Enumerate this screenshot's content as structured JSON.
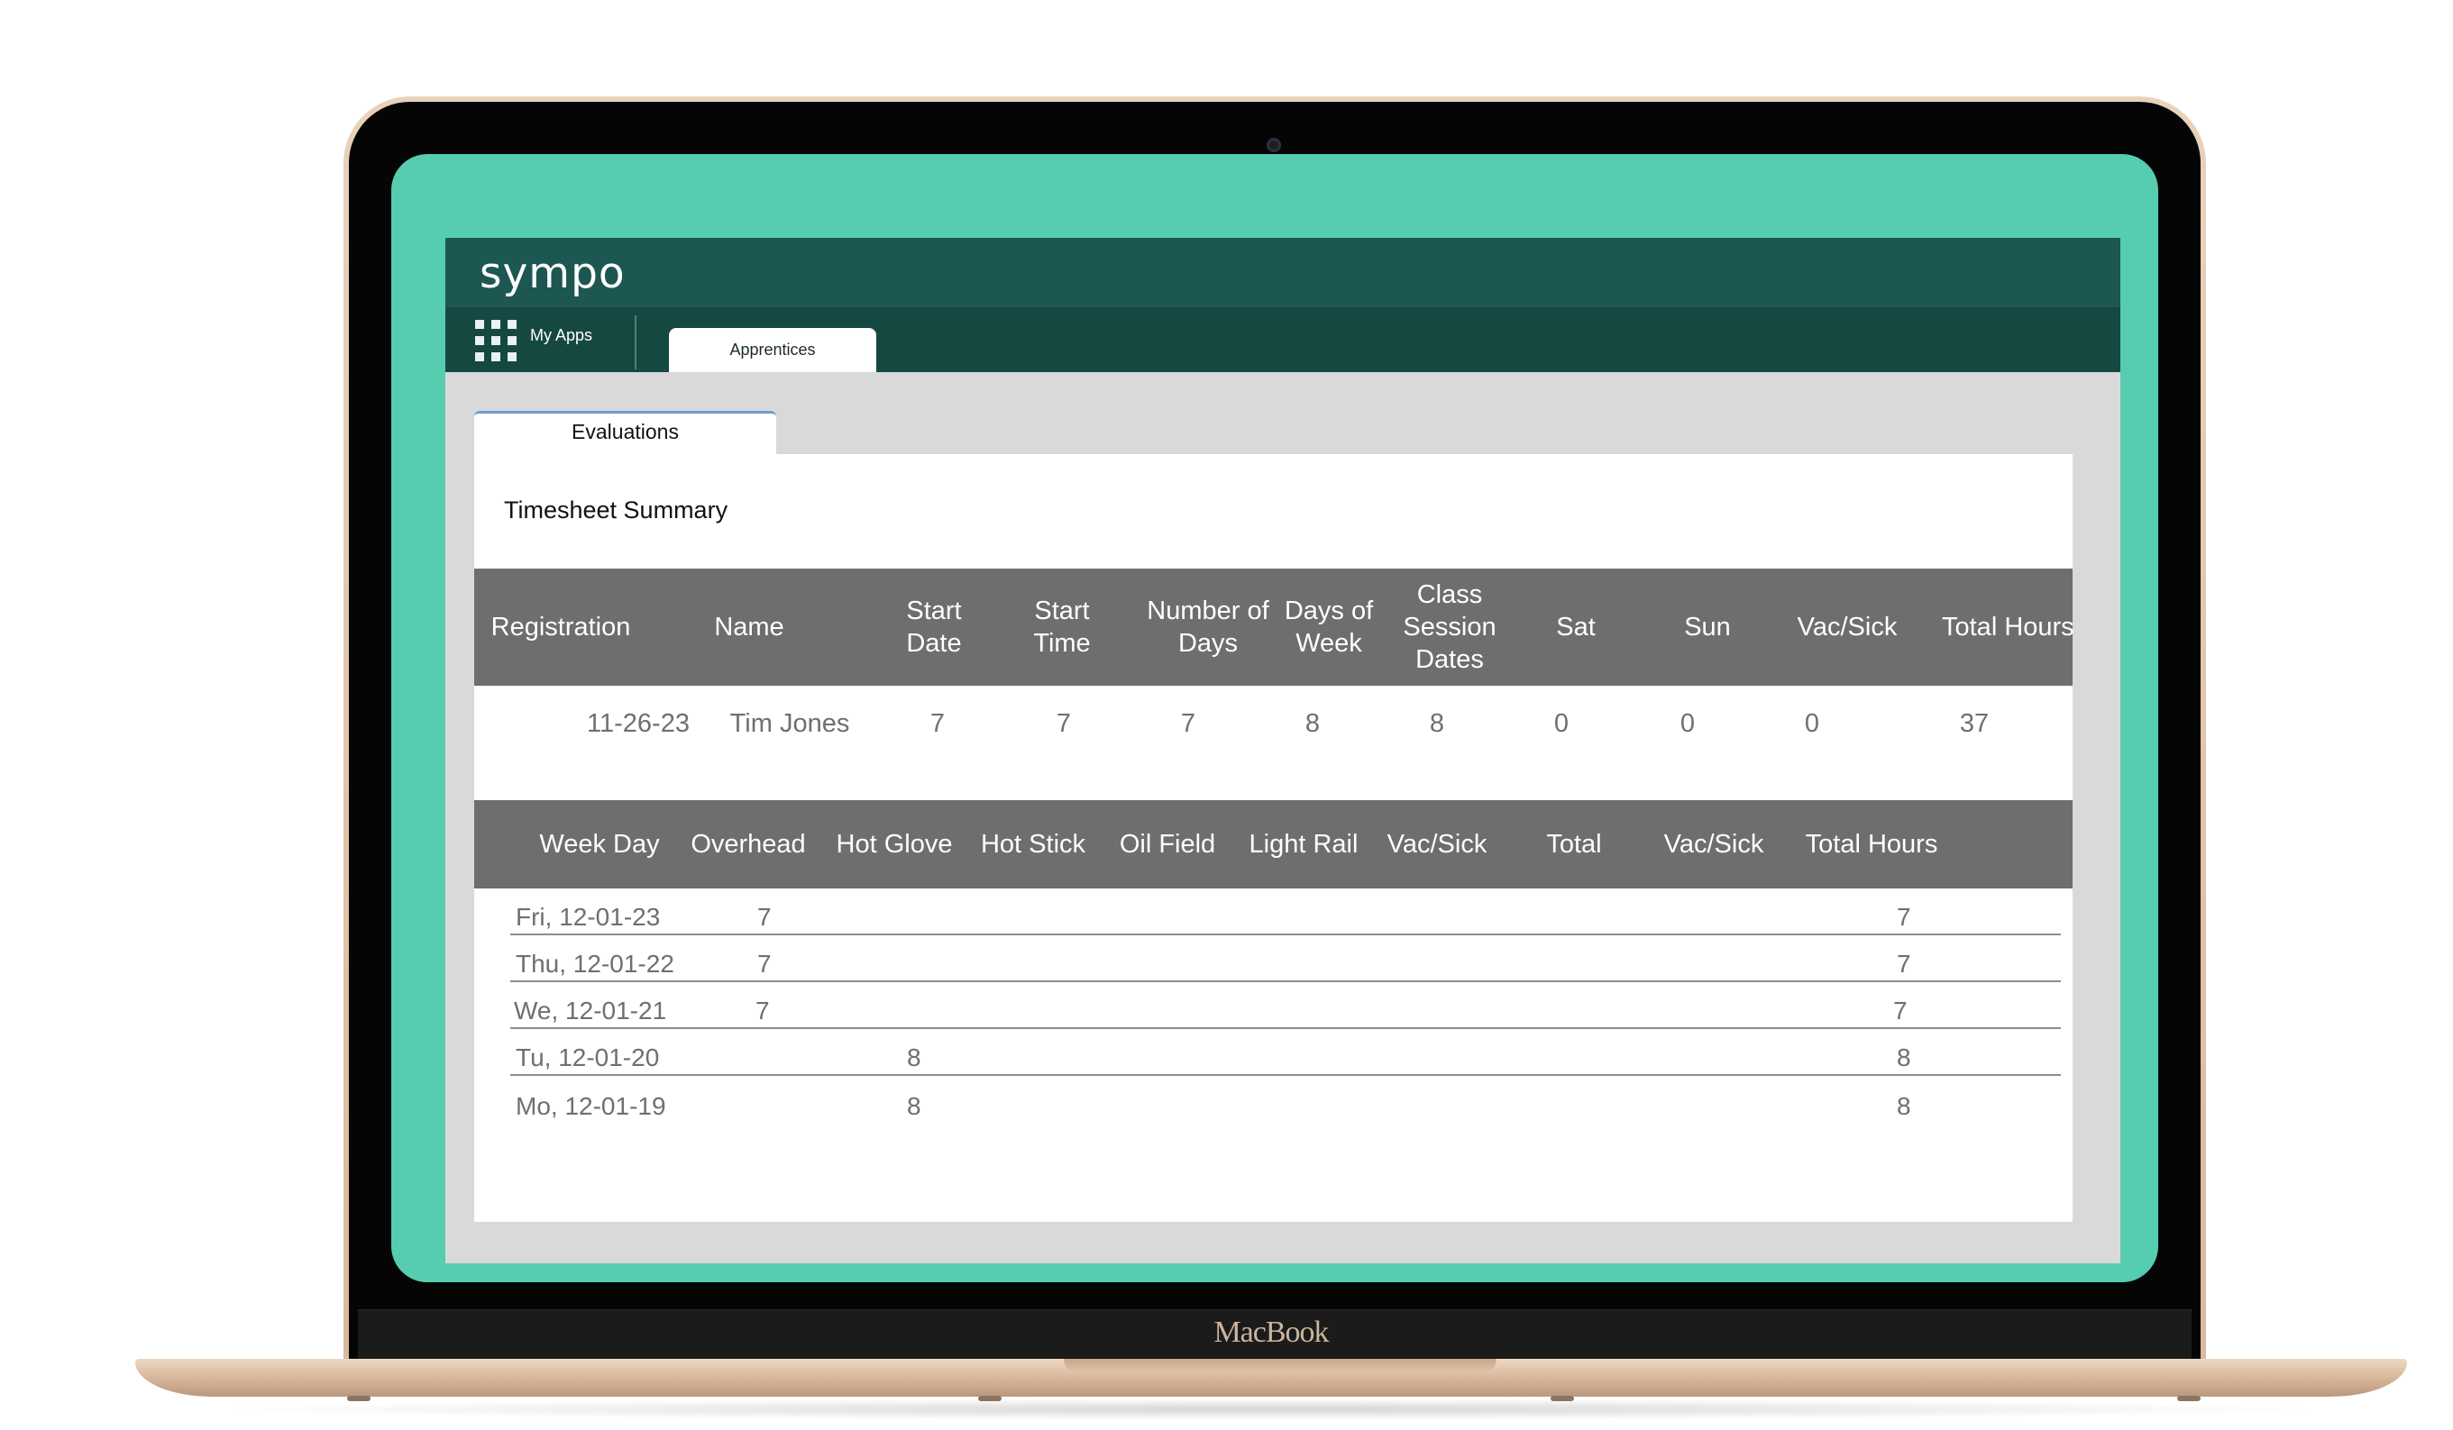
{
  "device": {
    "brand": "MacBook"
  },
  "app": {
    "logo": "sympo",
    "nav": {
      "my_apps_label": "My Apps",
      "active_tab": "Apprentices"
    },
    "subtab": "Evaluations"
  },
  "timesheet": {
    "title": "Timesheet Summary",
    "columns": [
      "Registration",
      "Name",
      "Start Date",
      "Start Time",
      "Number of Days",
      "Days of Week",
      "Class Session Dates",
      "Sat",
      "Sun",
      "Vac/Sick",
      "Total Hours"
    ],
    "rows": [
      [
        "11-26-23",
        "Tim Jones",
        "7",
        "7",
        "7",
        "8",
        "8",
        "0",
        "0",
        "0",
        "37"
      ]
    ]
  },
  "weekly": {
    "columns": [
      "Week Day",
      "Overhead",
      "Hot Glove",
      "Hot Stick",
      "Oil Field",
      "Light Rail",
      "Vac/Sick",
      "Total",
      "Vac/Sick",
      "Total Hours"
    ],
    "rows": [
      {
        "day": "Fri, 12-01-23",
        "overhead": "7",
        "hot_glove": "",
        "total_hours": "7"
      },
      {
        "day": "Thu, 12-01-22",
        "overhead": "7",
        "hot_glove": "",
        "total_hours": "7"
      },
      {
        "day": "We, 12-01-21",
        "overhead": "7",
        "hot_glove": "",
        "total_hours": "7"
      },
      {
        "day": "Tu, 12-01-20",
        "overhead": "",
        "hot_glove": "8",
        "total_hours": "8"
      },
      {
        "day": "Mo, 12-01-19",
        "overhead": "",
        "hot_glove": "8",
        "total_hours": "8"
      }
    ]
  },
  "colors": {
    "screen_background": "#56ccb1",
    "topbar": "#1d5751",
    "navbar": "#164842",
    "table_header": "#6e6e6e",
    "tab_accent": "#6d9dd2"
  }
}
